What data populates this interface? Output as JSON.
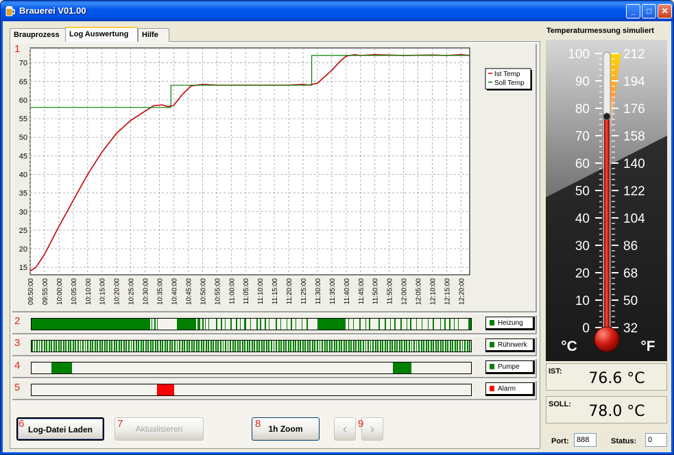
{
  "window": {
    "title": "Brauerei V01.00",
    "buttons": {
      "minimize": "_",
      "maximize": "□",
      "close": "✕"
    }
  },
  "tabs": [
    {
      "label": "Brauprozess"
    },
    {
      "label": "Log Auswertung",
      "active": true
    },
    {
      "label": "Hilfe"
    }
  ],
  "section_numbers": [
    "1",
    "2",
    "3",
    "4",
    "5",
    "6",
    "7",
    "8",
    "9"
  ],
  "chart_data": {
    "type": "line",
    "ylim": [
      13,
      74
    ],
    "yticks": [
      15,
      20,
      25,
      30,
      35,
      40,
      45,
      50,
      55,
      60,
      65,
      70
    ],
    "x_start": "09:50:00",
    "x_end": "12:23:00",
    "xticks": [
      "09:50:00",
      "09:55:00",
      "10:00:00",
      "10:05:00",
      "10:10:00",
      "10:15:00",
      "10:20:00",
      "10:25:00",
      "10:30:00",
      "10:35:00",
      "10:40:00",
      "10:45:00",
      "10:50:00",
      "10:55:00",
      "11:00:00",
      "11:05:00",
      "11:10:00",
      "11:15:00",
      "11:20:00",
      "11:25:00",
      "11:30:00",
      "11:35:00",
      "11:40:00",
      "11:45:00",
      "11:50:00",
      "11:55:00",
      "12:00:00",
      "12:05:00",
      "12:10:00",
      "12:15:00",
      "12:20:00"
    ],
    "grid": true,
    "legend_position": "top-right",
    "series": [
      {
        "name": "Ist Temp",
        "color": "#c00000",
        "x": [
          "09:50:00",
          "09:52:00",
          "09:55:00",
          "10:00:00",
          "10:05:00",
          "10:10:00",
          "10:15:00",
          "10:20:00",
          "10:25:00",
          "10:30:00",
          "10:33:00",
          "10:36:00",
          "10:38:00",
          "10:40:00",
          "10:43:00",
          "10:46:00",
          "10:50:00",
          "10:55:00",
          "11:00:00",
          "11:10:00",
          "11:20:00",
          "11:25:00",
          "11:27:00",
          "11:30:00",
          "11:35:00",
          "11:38:00",
          "11:40:00",
          "11:43:00",
          "11:45:00",
          "11:50:00",
          "12:00:00",
          "12:10:00",
          "12:15:00",
          "12:20:00",
          "12:23:00"
        ],
        "values": [
          14.0,
          15.0,
          18.5,
          26.0,
          33.0,
          40.0,
          46.0,
          51.0,
          54.5,
          57.0,
          58.5,
          58.7,
          58.2,
          58.6,
          61.5,
          63.8,
          64.2,
          64.0,
          64.0,
          64.0,
          64.0,
          64.2,
          64.0,
          64.5,
          68.0,
          70.5,
          71.8,
          72.2,
          72.0,
          72.2,
          72.0,
          72.1,
          72.0,
          72.2,
          72.0
        ]
      },
      {
        "name": "Soll Temp",
        "color": "#008000",
        "x": [
          "09:50:00",
          "10:39:00",
          "10:39:00",
          "11:28:00",
          "11:28:00",
          "12:23:00"
        ],
        "values": [
          58,
          58,
          64,
          64,
          72,
          72
        ]
      }
    ]
  },
  "strips": [
    {
      "label": "Heizung",
      "color": "#008000",
      "segments": [
        [
          0,
          27
        ],
        [
          27.3,
          27.5
        ],
        [
          28,
          28.2
        ],
        [
          28.5,
          28.6
        ],
        [
          33,
          37.4
        ],
        [
          37.8,
          38.3
        ],
        [
          38.8,
          39.1
        ],
        [
          39.5,
          39.7
        ],
        [
          40.2,
          40.3
        ],
        [
          42,
          42.3
        ],
        [
          43,
          43.4
        ],
        [
          44,
          44.2
        ],
        [
          45.3,
          45.5
        ],
        [
          46.5,
          46.8
        ],
        [
          47.5,
          47.6
        ],
        [
          48.4,
          48.8
        ],
        [
          49.8,
          50
        ],
        [
          51.2,
          51.5
        ],
        [
          52,
          52.2
        ],
        [
          53,
          53.3
        ],
        [
          54,
          54.1
        ],
        [
          55.5,
          55.8
        ],
        [
          56.6,
          56.8
        ],
        [
          58,
          58.2
        ],
        [
          59,
          59.3
        ],
        [
          60.1,
          60.2
        ],
        [
          61.5,
          61.7
        ],
        [
          62.5,
          62.9
        ],
        [
          65,
          71.5
        ],
        [
          72,
          72.3
        ],
        [
          73.2,
          73.4
        ],
        [
          74.6,
          74.9
        ],
        [
          76,
          76.2
        ],
        [
          76.8,
          77.1
        ],
        [
          79,
          79.3
        ],
        [
          80.4,
          80.6
        ],
        [
          81.6,
          81.8
        ],
        [
          82.6,
          82.9
        ],
        [
          84,
          84.3
        ],
        [
          85.3,
          85.5
        ],
        [
          86.1,
          86.4
        ],
        [
          87.5,
          87.7
        ],
        [
          88.8,
          89
        ],
        [
          90.1,
          90.3
        ],
        [
          91.2,
          91.5
        ],
        [
          93,
          93.2
        ],
        [
          93.9,
          94.2
        ],
        [
          95,
          95.3
        ],
        [
          96.1,
          96.3
        ],
        [
          97,
          97.2
        ],
        [
          99.3,
          100
        ]
      ]
    },
    {
      "label": "Rührwerk",
      "color": "#008000",
      "pattern": "dense"
    },
    {
      "label": "Pumpe",
      "color": "#008000",
      "segments": [
        [
          4.5,
          9.2
        ],
        [
          82.2,
          86.5
        ]
      ]
    },
    {
      "label": "Alarm",
      "color": "#ff0000",
      "segments": [
        [
          28.5,
          32.5
        ]
      ]
    }
  ],
  "buttons": {
    "load": "Log-Datei Laden",
    "refresh": "Aktualisieren",
    "zoom": "1h Zoom",
    "prev": "‹",
    "next": "›"
  },
  "right_panel": {
    "title": "Temperaturmessung simuliert",
    "celsius_scale": [
      "100",
      "90",
      "80",
      "70",
      "60",
      "50",
      "40",
      "30",
      "20",
      "10",
      "0"
    ],
    "fahrenheit_scale": [
      "212",
      "194",
      "176",
      "158",
      "140",
      "122",
      "104",
      "86",
      "68",
      "50",
      "32"
    ],
    "celsius_unit": "°C",
    "fahrenheit_unit": "°F",
    "thermometer_level_c": 77,
    "ist_label": "IST:",
    "ist_value": "76.6 °C",
    "soll_label": "SOLL:",
    "soll_value": "78.0 °C",
    "port_label": "Port:",
    "port_value": "888",
    "status_label": "Status:",
    "status_value": "0"
  }
}
